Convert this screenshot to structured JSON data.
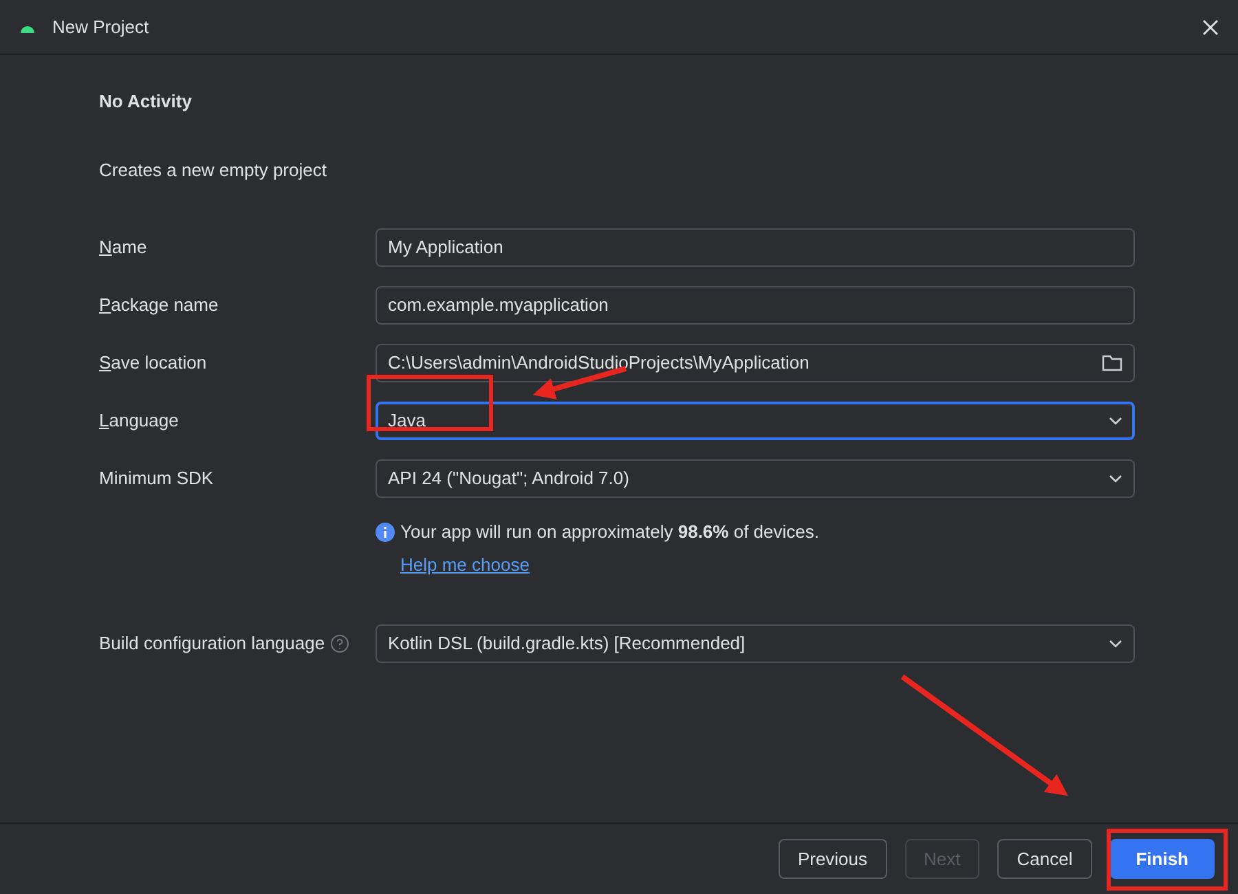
{
  "window": {
    "title": "New Project"
  },
  "template": {
    "title": "No Activity",
    "description": "Creates a new empty project"
  },
  "fields": [
    {
      "kind": "text",
      "label": "Name",
      "mnemonic": true,
      "value": "My Application",
      "focused": false
    },
    {
      "kind": "text",
      "label": "Package name",
      "mnemonic": true,
      "value": "com.example.myapplication",
      "focused": false
    },
    {
      "kind": "folder",
      "label": "Save location",
      "mnemonic": true,
      "value": "C:\\Users\\admin\\AndroidStudioProjects\\MyApplication",
      "focused": false
    },
    {
      "kind": "dropdown",
      "label": "Language",
      "mnemonic": true,
      "value": "Java",
      "focused": true
    },
    {
      "kind": "dropdown",
      "label": "Minimum SDK",
      "mnemonic": false,
      "value": "API 24 (\"Nougat\"; Android 7.0)",
      "focused": false
    }
  ],
  "sdk_info": {
    "text": "Your app will run on approximately **98.6%** of devices.",
    "link": "Help me choose"
  },
  "build_config": {
    "kind": "dropdown",
    "label": "Build configuration language",
    "mnemonic": false,
    "help": true,
    "value": "Kotlin DSL (build.gradle.kts) [Recommended]",
    "focused": false
  },
  "buttons": [
    {
      "label": "Previous",
      "kind": "default",
      "disabled": false
    },
    {
      "label": "Next",
      "kind": "default",
      "disabled": true
    },
    {
      "label": "Cancel",
      "kind": "default",
      "disabled": false
    },
    {
      "label": "Finish",
      "kind": "primary",
      "disabled": false
    }
  ]
}
